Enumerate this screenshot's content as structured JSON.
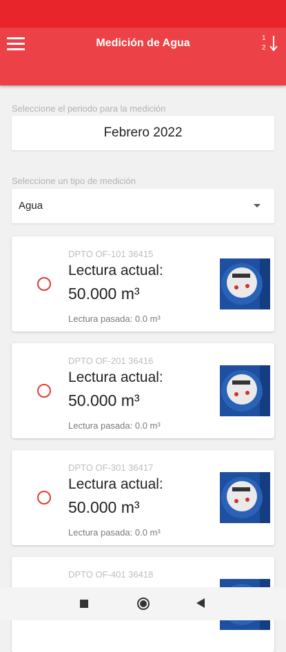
{
  "header": {
    "title": "Medición de Agua",
    "menu_icon": "hamburger-menu-icon",
    "sort_icon": "sort-numeric-icon"
  },
  "colors": {
    "status_bar": "#e8252b",
    "app_bar": "#ec4146",
    "radio": "#e53935"
  },
  "period": {
    "label": "Seleccione el periodo para la medición",
    "value": "Febrero 2022"
  },
  "measure_type": {
    "label": "Seleccione un tipo de medición",
    "value": "Agua"
  },
  "readings": [
    {
      "unit": "DPTO OF-101 36415",
      "current_label": "Lectura actual:",
      "current_value": "50.000 m³",
      "past": "Lectura pasada: 0.0 m³"
    },
    {
      "unit": "DPTO OF-201 36416",
      "current_label": "Lectura actual:",
      "current_value": "50.000 m³",
      "past": "Lectura pasada: 0.0 m³"
    },
    {
      "unit": "DPTO OF-301 36417",
      "current_label": "Lectura actual:",
      "current_value": "50.000 m³",
      "past": "Lectura pasada: 0.0 m³"
    },
    {
      "unit": "DPTO OF-401 36418",
      "current_label": "",
      "current_value": "",
      "past": ""
    }
  ]
}
